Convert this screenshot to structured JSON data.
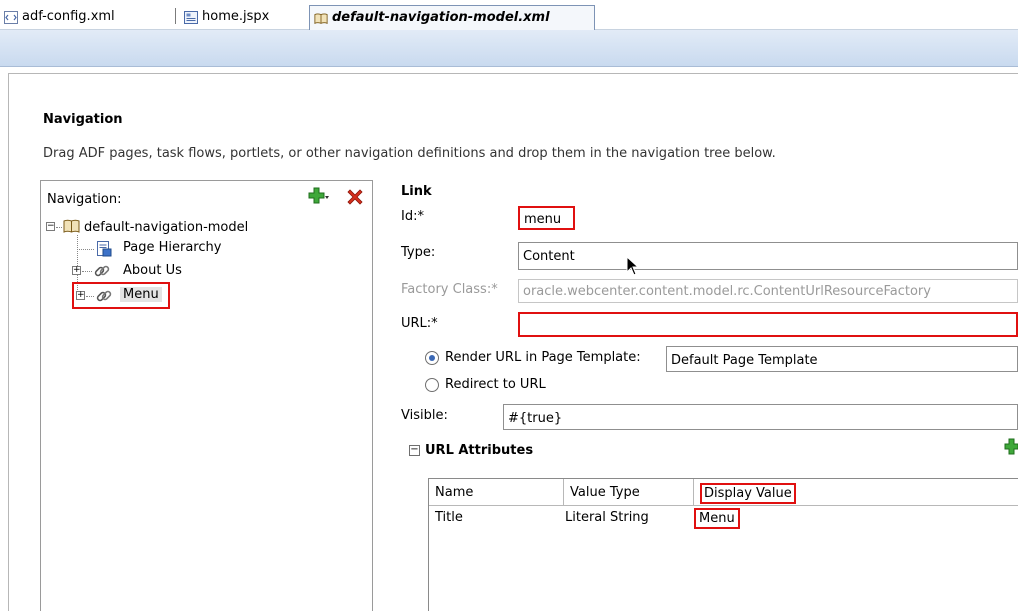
{
  "tabs": [
    {
      "label": "adf-config.xml",
      "icon": "xml-file-icon"
    },
    {
      "label": "home.jspx",
      "icon": "jspx-file-icon"
    },
    {
      "label": "default-navigation-model.xml",
      "icon": "navigation-model-icon",
      "active": true
    }
  ],
  "page": {
    "heading": "Navigation",
    "description": "Drag ADF pages, task flows, portlets, or other navigation definitions and drop them in the navigation tree below."
  },
  "tree": {
    "header": "Navigation:",
    "root": "default-navigation-model",
    "items": [
      "Page Hierarchy",
      "About Us",
      "Menu"
    ],
    "selected": "Menu"
  },
  "form": {
    "section_label": "Link",
    "id_label": "Id:*",
    "id_value": "menu",
    "type_label": "Type:",
    "type_value": "Content",
    "factory_label": "Factory Class:*",
    "factory_value": "oracle.webcenter.content.model.rc.ContentUrlResourceFactory",
    "url_label": "URL:*",
    "url_value": "",
    "render_option": "Render URL in Page Template:",
    "template_value": "Default Page Template",
    "redirect_option": "Redirect to URL",
    "visible_label": "Visible:",
    "visible_value": "#{true}"
  },
  "url_attributes": {
    "title": "URL Attributes",
    "columns": [
      "Name",
      "Value Type",
      "Display Value"
    ],
    "rows": [
      {
        "name": "Title",
        "value_type": "Literal String",
        "display_value": "Menu"
      }
    ]
  },
  "colors": {
    "highlight": "#e01010",
    "accent": "#3a68b5",
    "tab_bar": "#c9daef"
  }
}
